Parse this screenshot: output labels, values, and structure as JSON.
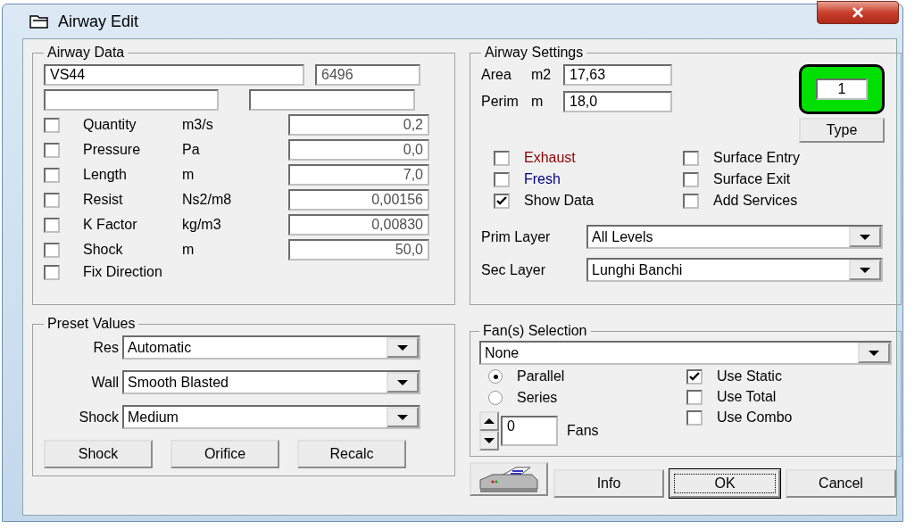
{
  "window": {
    "title": "Airway Edit"
  },
  "airway_data": {
    "title": "Airway Data",
    "name": "VS44",
    "number": "6496",
    "rows": [
      {
        "label": "Quantity",
        "unit": "m3/s",
        "checked": false,
        "value": "0,2"
      },
      {
        "label": "Pressure",
        "unit": "Pa",
        "checked": false,
        "value": "0,0"
      },
      {
        "label": "Length",
        "unit": "m",
        "checked": false,
        "value": "7,0"
      },
      {
        "label": "Resist",
        "unit": "Ns2/m8",
        "checked": false,
        "value": "0,00156"
      },
      {
        "label": "K Factor",
        "unit": "kg/m3",
        "checked": false,
        "value": "0,00830"
      },
      {
        "label": "Shock",
        "unit": "m",
        "checked": false,
        "value": "50,0"
      }
    ],
    "fix_direction": {
      "label": "Fix Direction",
      "checked": false
    }
  },
  "airway_settings": {
    "title": "Airway Settings",
    "fields": [
      {
        "label": "Area",
        "unit": "m2",
        "value": "17,63"
      },
      {
        "label": "Perim",
        "unit": "m",
        "value": "18,0"
      }
    ],
    "type_indicator": {
      "value": "1",
      "color": "#00e000"
    },
    "type_button": "Type",
    "checkboxes": [
      {
        "label": "Exhaust",
        "checked": false,
        "color": "#8b0000"
      },
      {
        "label": "Surface Entry",
        "checked": false,
        "color": "#000000"
      },
      {
        "label": "Fresh",
        "checked": false,
        "color": "#000080"
      },
      {
        "label": "Surface Exit",
        "checked": false,
        "color": "#000000"
      },
      {
        "label": "Show Data",
        "checked": true,
        "color": "#000000"
      },
      {
        "label": "Add Services",
        "checked": false,
        "color": "#000000"
      }
    ],
    "layers": [
      {
        "label": "Prim Layer",
        "value": "All Levels"
      },
      {
        "label": "Sec Layer",
        "value": "Lunghi Banchi"
      }
    ]
  },
  "preset_values": {
    "title": "Preset Values",
    "dropdowns": [
      {
        "label": "Res",
        "value": "Automatic"
      },
      {
        "label": "Wall",
        "value": "Smooth Blasted"
      },
      {
        "label": "Shock",
        "value": "Medium"
      }
    ],
    "buttons": [
      "Shock",
      "Orifice",
      "Recalc"
    ]
  },
  "fan_selection": {
    "title": "Fan(s) Selection",
    "value": "None",
    "modes": [
      {
        "label": "Parallel",
        "selected": true
      },
      {
        "label": "Series",
        "selected": false
      }
    ],
    "count": "0",
    "count_label": "Fans",
    "options": [
      {
        "label": "Use Static",
        "checked": true
      },
      {
        "label": "Use Total",
        "checked": false
      },
      {
        "label": "Use Combo",
        "checked": false
      }
    ]
  },
  "buttons": [
    {
      "label": "Info",
      "focused": false
    },
    {
      "label": "OK",
      "focused": true
    },
    {
      "label": "Cancel",
      "focused": false
    }
  ]
}
